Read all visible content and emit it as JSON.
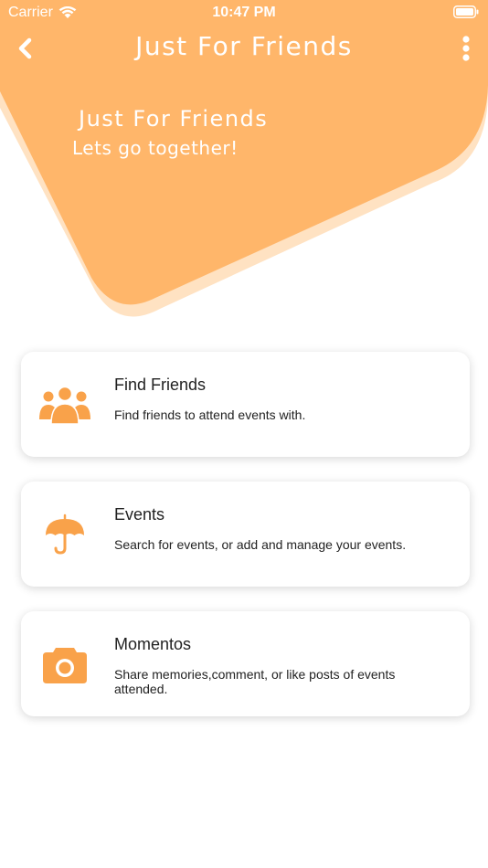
{
  "colors": {
    "accent": "#FFB66A",
    "accent_shadow": "#FFE2C2",
    "icon": "#F9A24A",
    "text": "#222222",
    "white": "#FFFFFF"
  },
  "status_bar": {
    "carrier": "Carrier",
    "time": "10:47 PM",
    "icons": [
      "wifi-icon",
      "battery-icon"
    ]
  },
  "nav": {
    "title": "Just For Friends",
    "back_icon": "chevron-left-icon",
    "menu_icon": "more-vertical-icon"
  },
  "hero": {
    "title": "Just For Friends",
    "subtitle": "Lets go together!"
  },
  "menu_cards": [
    {
      "icon": "group-icon",
      "title": "Find Friends",
      "description": "Find friends to attend events with."
    },
    {
      "icon": "umbrella-icon",
      "title": "Events",
      "description": "Search for events, or add and manage your events."
    },
    {
      "icon": "camera-icon",
      "title": "Momentos",
      "description": "Share memories,comment, or like posts of events attended."
    }
  ]
}
